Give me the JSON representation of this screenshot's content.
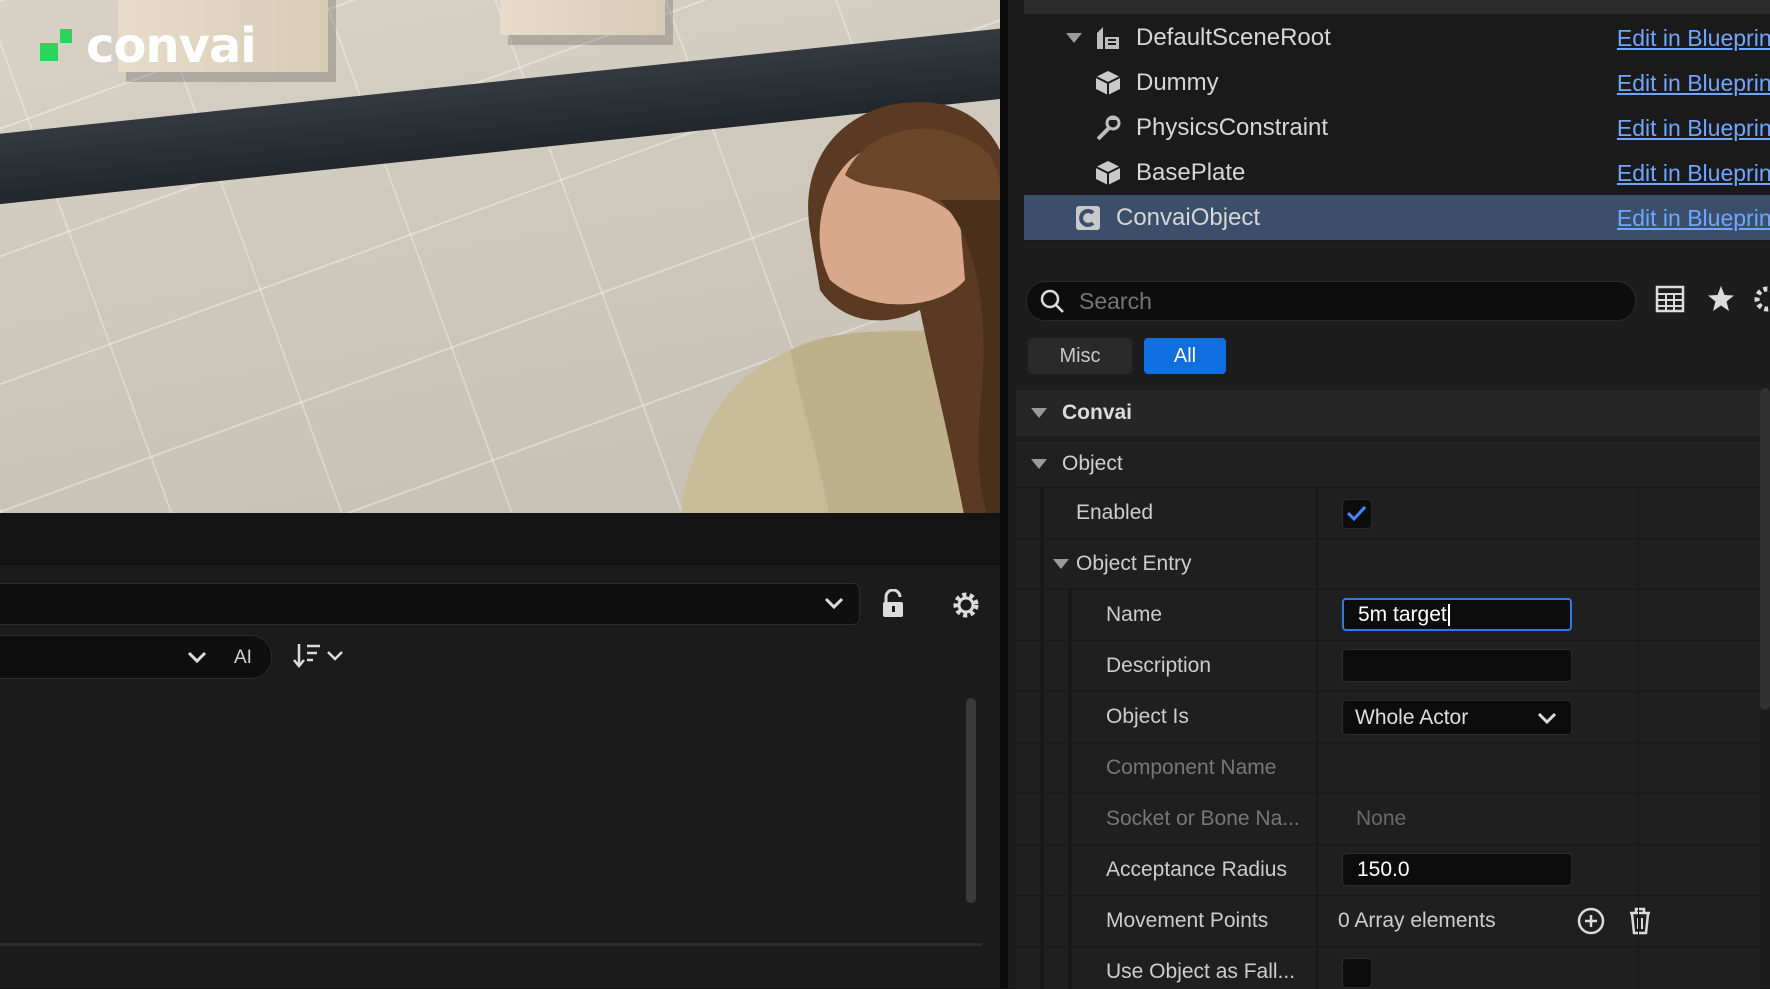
{
  "viewport": {
    "logo_text": "convai",
    "brand_color": "#2bd45b"
  },
  "lower_panel": {
    "filter_label": "AI"
  },
  "component_tree": {
    "items": [
      {
        "label": "DefaultSceneRoot",
        "icon": "scene-root-icon",
        "link": "Edit in Blueprint"
      },
      {
        "label": "Dummy",
        "icon": "static-mesh-icon",
        "link": "Edit in Blueprint"
      },
      {
        "label": "PhysicsConstraint",
        "icon": "physics-constraint-icon",
        "link": "Edit in Blueprint"
      },
      {
        "label": "BasePlate",
        "icon": "static-mesh-icon",
        "link": "Edit in Blueprint"
      },
      {
        "label": "ConvaiObject",
        "icon": "component-icon",
        "link": "Edit in Blueprint",
        "selected": true
      }
    ]
  },
  "details": {
    "search_placeholder": "Search",
    "tabs": [
      "Misc",
      "All"
    ],
    "active_tab": "All",
    "category": "Convai",
    "section": "Object",
    "enabled_label": "Enabled",
    "enabled_checked": true,
    "object_entry_label": "Object Entry",
    "properties": {
      "name_label": "Name",
      "name_value": "5m target",
      "description_label": "Description",
      "description_value": "",
      "object_is_label": "Object Is",
      "object_is_value": "Whole Actor",
      "component_name_label": "Component Name",
      "socket_label": "Socket or Bone Na...",
      "socket_value": "None",
      "acceptance_radius_label": "Acceptance Radius",
      "acceptance_radius_value": "150.0",
      "movement_points_label": "Movement Points",
      "movement_points_value": "0 Array elements",
      "use_object_label": "Use Object as Fall..."
    }
  },
  "colors": {
    "accent_blue": "#0f6fe0",
    "selection": "#3b4e6a",
    "link": "#6fa6ff"
  }
}
